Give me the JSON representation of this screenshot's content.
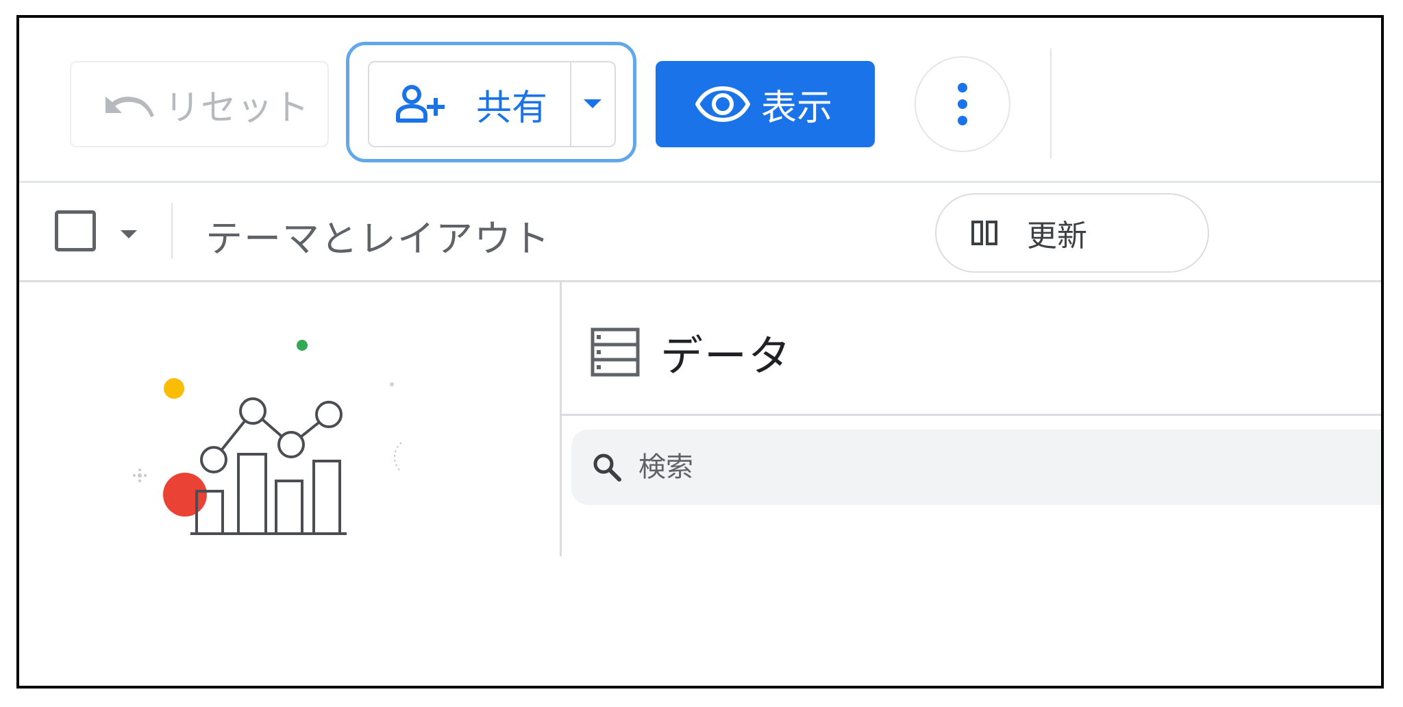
{
  "toolbar": {
    "reset_label": "リセット",
    "share_label": "共有",
    "view_label": "表示"
  },
  "subtoolbar": {
    "theme_layout_label": "テーマとレイアウト",
    "refresh_label": "更新"
  },
  "data_panel": {
    "title": "データ",
    "search_placeholder": "検索"
  },
  "colors": {
    "primary": "#1a73e8",
    "highlight": "#62a7ea",
    "red": "#ea4335",
    "yellow": "#fbbc04",
    "green": "#34a853"
  }
}
